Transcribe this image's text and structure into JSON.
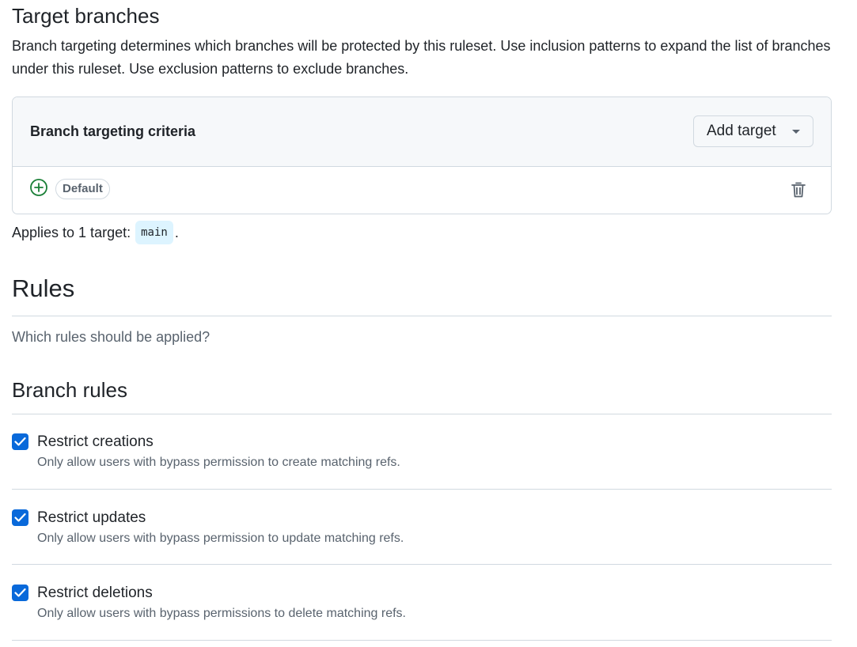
{
  "target_section": {
    "title": "Target branches",
    "description": "Branch targeting determines which branches will be protected by this ruleset. Use inclusion patterns to expand the list of branches under this ruleset. Use exclusion patterns to exclude branches."
  },
  "criteria_box": {
    "title": "Branch targeting criteria",
    "add_button_label": "Add target",
    "row": {
      "badge": "Default"
    }
  },
  "applies": {
    "prefix": "Applies to 1 target:",
    "target": "main",
    "suffix": "."
  },
  "rules_section": {
    "title": "Rules",
    "subtitle": "Which rules should be applied?"
  },
  "branch_rules": {
    "title": "Branch rules",
    "items": [
      {
        "label": "Restrict creations",
        "description": "Only allow users with bypass permission to create matching refs.",
        "checked": true
      },
      {
        "label": "Restrict updates",
        "description": "Only allow users with bypass permission to update matching refs.",
        "checked": true
      },
      {
        "label": "Restrict deletions",
        "description": "Only allow users with bypass permissions to delete matching refs.",
        "checked": true
      }
    ]
  },
  "icons": {
    "add": "plus-circle-icon",
    "delete": "trash-icon",
    "dropdown": "caret-down-icon",
    "check": "check-icon"
  },
  "colors": {
    "accent": "#0969da",
    "success": "#1a7f37",
    "border": "#d1d9e0",
    "muted_text": "#59636e",
    "code_bg": "#ddf4ff"
  }
}
